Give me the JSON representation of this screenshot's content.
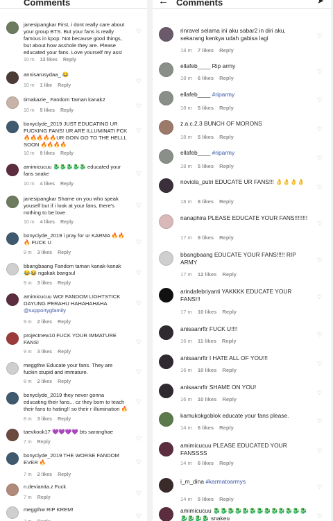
{
  "header": {
    "title": "Comments"
  },
  "left": [
    {
      "user": "janesipangkar",
      "text": "First, i dont really care about your group BTS. But your fans is really famous in kpop. Not because good things, but about how asshole they are. Please educated your fans. Love yourself my ass!",
      "time": "10 m",
      "likes": "13 likes",
      "reply": "Reply",
      "avatar_color": "#6d7b5f"
    },
    {
      "user": "annisarusydaa_",
      "text": "😂",
      "time": "10 m",
      "likes": "1 like",
      "reply": "Reply",
      "avatar_color": "#4d3b36"
    },
    {
      "user": "timakazie_",
      "text": "Fandom Taman kanak2",
      "time": "10 m",
      "likes": "5 likes",
      "reply": "Reply",
      "avatar_color": "#c8b3a8"
    },
    {
      "user": "bonyclyde_2019",
      "text": "JUST EDUCATING UR FUCKING FANS! UR ARE ILLUMINATI FCK🔥🔥🔥🔥🔥UR GOIN GO TO THE HELLL SOON 🔥🔥🔥🔥",
      "time": "10 m",
      "likes": "9 likes",
      "reply": "Reply",
      "avatar_color": "#3f5a6f"
    },
    {
      "user": "amimicucuu",
      "text": "🐉🐉🐉🐉🐉 educated your fans snake",
      "time": "10 m",
      "likes": "4 likes",
      "reply": "Reply",
      "avatar_color": "#5b2d3f"
    },
    {
      "user": "janesipangkar",
      "text": "Shame on you who speak youself but if i look at your fans, there's nothing to be love",
      "time": "10 m",
      "likes": "4 likes",
      "reply": "Reply",
      "avatar_color": "#6d7b5f"
    },
    {
      "user": "bonyclyde_2019",
      "text": "i pray for ur KARMA 🔥🔥🔥 FUCK U",
      "time": "9 m",
      "likes": "3 likes",
      "reply": "Reply",
      "avatar_color": "#3f5a6f"
    },
    {
      "user": "bbangbaang",
      "text": "Fandom taman kanak-kanak 😂😂 ngakak bangsul",
      "time": "9 m",
      "likes": "3 likes",
      "reply": "Reply",
      "avatar_color": "#cfcfcf"
    },
    {
      "user": "amimicucuu",
      "text": "WO! FANDOM LIGHTSTICK DAYUNG PERAHU HAHAHAHAHA",
      "mention": "@supportygfamily",
      "time": "9 m",
      "likes": "2 likes",
      "reply": "Reply",
      "avatar_color": "#5b2d3f"
    },
    {
      "user": "projectnew10",
      "text": "FUCK YOUR IMMATURE FANS!",
      "time": "9 m",
      "likes": "3 likes",
      "reply": "Reply",
      "avatar_color": "#9d3b3b"
    },
    {
      "user": "meggthw",
      "text": "Educate your fans. They are fuckin stupid and immature.",
      "time": "8 m",
      "likes": "2 likes",
      "reply": "Reply",
      "avatar_color": "#cfcfcf"
    },
    {
      "user": "bonyclyde_2019",
      "text": "they never gonna educating their fans... cz they born to teach their fans to hating!! so their r illumination 🔥",
      "time": "8 m",
      "likes": "3 likes",
      "reply": "Reply",
      "avatar_color": "#3f5a6f"
    },
    {
      "user": "taevkook17",
      "text": "💜💜💜💜 bts saranghae",
      "time": "7 m",
      "likes": "",
      "reply": "Reply",
      "avatar_color": "#6b4b3f"
    },
    {
      "user": "bonyclyde_2019",
      "text": "THE WORSE FANDOM EVER 🔥",
      "time": "7 m",
      "likes": "2 likes",
      "reply": "Reply",
      "avatar_color": "#3f5a6f"
    },
    {
      "user": "n.devianita.z",
      "text": "Fuck",
      "time": "7 m",
      "likes": "",
      "reply": "Reply",
      "avatar_color": "#b08a7a"
    },
    {
      "user": "meggthw",
      "text": "RIP KREM!",
      "time": "7 m",
      "likes": "",
      "reply": "Reply",
      "avatar_color": "#cfcfcf"
    }
  ],
  "right": [
    {
      "user": "rinravel",
      "text": "selama ini aku sabar2 in diri aku, sekarang kenkya udah gabisa lagi",
      "time": "18 m",
      "likes": "7 likes",
      "reply": "Reply",
      "avatar_color": "#6a5a6a"
    },
    {
      "user": "ellafeb____",
      "text": "Rip army",
      "time": "18 m",
      "likes": "6 likes",
      "reply": "Reply",
      "avatar_color": "#8a8f8a"
    },
    {
      "user": "ellafeb____",
      "text": "",
      "mention": "#riparmy",
      "time": "18 m",
      "likes": "5 likes",
      "reply": "Reply",
      "avatar_color": "#8a8f8a"
    },
    {
      "user": "z.a.c.2.3",
      "text": "BUNCH OF MORONS",
      "time": "18 m",
      "likes": "5 likes",
      "reply": "Reply",
      "avatar_color": "#9c7a6a"
    },
    {
      "user": "ellafeb____",
      "text": "",
      "mention": "#riparmy",
      "time": "18 m",
      "likes": "5 likes",
      "reply": "Reply",
      "avatar_color": "#8a8f8a"
    },
    {
      "user": "noviola_putri",
      "text": "EDUCATE UR FANS!!! 👌👌👌👌",
      "time": "18 m",
      "likes": "8 likes",
      "reply": "Reply",
      "avatar_color": "#3a2f3a"
    },
    {
      "user": "nanaphira",
      "text": "PLEASE EDUCATE YOUR FANS!!!!!!!!",
      "time": "17 m",
      "likes": "9 likes",
      "reply": "Reply",
      "avatar_color": "#d8b8b8"
    },
    {
      "user": "bbangbaang",
      "text": "EDUCATE YOUR FANS!!!!! RIP ARMY",
      "time": "17 m",
      "likes": "12 likes",
      "reply": "Reply",
      "avatar_color": "#cfcfcf"
    },
    {
      "user": "arindafebriyanti",
      "text": "YAKKKK EDUCATE YOUR FANS!!!",
      "time": "17 m",
      "likes": "10 likes",
      "reply": "Reply",
      "avatar_color": "#111111"
    },
    {
      "user": "anisaanrftr",
      "text": "FUCK U!!!!",
      "time": "16 m",
      "likes": "11 likes",
      "reply": "Reply",
      "avatar_color": "#2f2a30"
    },
    {
      "user": "anisaanrftr",
      "text": "I HATE ALL OF YOU!!!",
      "time": "16 m",
      "likes": "10 likes",
      "reply": "Reply",
      "avatar_color": "#2f2a30"
    },
    {
      "user": "anisaanrftr",
      "text": "SHAME ON YOU!",
      "time": "16 m",
      "likes": "10 likes",
      "reply": "Reply",
      "avatar_color": "#2f2a30"
    },
    {
      "user": "kamukokgoblok",
      "text": "educate your fans please.",
      "time": "14 m",
      "likes": "6 likes",
      "reply": "Reply",
      "avatar_color": "#5c7a4c"
    },
    {
      "user": "amimicucuu",
      "text": "PLEASE EDUCATED YOUR FANSSSS",
      "time": "14 m",
      "likes": "6 likes",
      "reply": "Reply",
      "avatar_color": "#5b2d3f"
    },
    {
      "user": "i_m_dina",
      "text": "",
      "mention": "#karmatoarmys",
      "time": "14 m",
      "likes": "5 likes",
      "reply": "Reply",
      "avatar_color": "#3a2a2a"
    },
    {
      "user": "amimicucuu",
      "text": "🐉🐉🐉🐉🐉🐉🐉🐉🐉🐉🐉🐉🐉🐉🐉🐉🐉 snakeu",
      "time": "",
      "likes": "",
      "reply": "",
      "avatar_color": "#5b2d3f"
    }
  ]
}
